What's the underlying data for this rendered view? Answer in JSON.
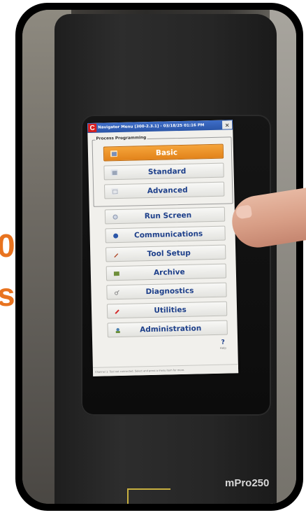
{
  "overlay": {
    "left_text_top": "0",
    "left_text_bottom": "s"
  },
  "device": {
    "model_label": "mPro250"
  },
  "window": {
    "app_icon_letter": "C",
    "title": "Navigator Menu [300-2.3.1] - 03/18/25 01:16 PM",
    "close_label": "×"
  },
  "process_programming": {
    "label": "Process Programming",
    "buttons": [
      {
        "label": "Basic",
        "icon": "basic-icon",
        "selected": true
      },
      {
        "label": "Standard",
        "icon": "standard-icon",
        "selected": false
      },
      {
        "label": "Advanced",
        "icon": "advanced-icon",
        "selected": false
      }
    ]
  },
  "menu": {
    "items": [
      {
        "label": "Run Screen",
        "icon": "run-screen-icon"
      },
      {
        "label": "Communications",
        "icon": "communications-icon"
      },
      {
        "label": "Tool Setup",
        "icon": "tool-setup-icon"
      },
      {
        "label": "Archive",
        "icon": "archive-icon"
      },
      {
        "label": "Diagnostics",
        "icon": "diagnostics-icon"
      },
      {
        "label": "Utilities",
        "icon": "utilities-icon"
      },
      {
        "label": "Administration",
        "icon": "administration-icon"
      }
    ]
  },
  "help": {
    "glyph": "?",
    "label": "Help"
  },
  "status": {
    "message": "Channel 1: Tool not connected. Select and press a menu item for more."
  },
  "colors": {
    "accent_orange": "#e8731f",
    "selected_button": "#f0962a",
    "label_blue": "#1d3f8a",
    "titlebar_blue": "#2b56a8"
  }
}
